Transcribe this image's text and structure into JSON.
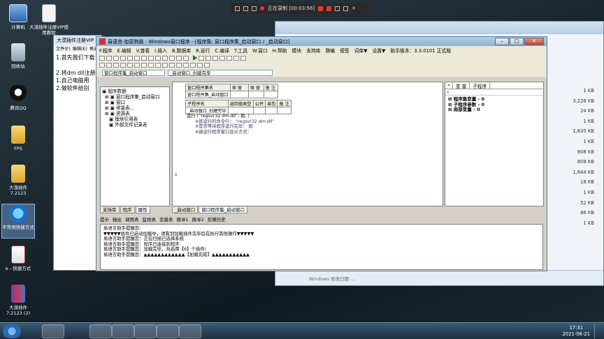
{
  "desktop": {
    "icons": [
      {
        "label": "计算机"
      },
      {
        "label": "大漠插件注册VIP使用教程"
      },
      {
        "label": "回收站"
      },
      {
        "label": "腾讯QQ"
      },
      {
        "label": "FPS"
      },
      {
        "label": "大漠插件 7.2123"
      },
      {
        "label": "不常用快捷方式"
      },
      {
        "label": "e - 快捷方式"
      },
      {
        "label": "大漠插件 7.2123 (2)"
      }
    ]
  },
  "recorder": {
    "status": "正在录制 [00:03:56]"
  },
  "notepad": {
    "title": "大漠插件注册VIP",
    "menu": [
      "文件(F)",
      "编辑(E)",
      "格式(O)"
    ],
    "lines": [
      "1.首先我们下载",
      "",
      "2.将dm.dll注册",
      "1.自己电脑用",
      "2.做软件给别"
    ]
  },
  "explorer": {
    "sizes": [
      "1 KB",
      "3,226 KB",
      "24 KB",
      "1 KB",
      "1,835 KB",
      "1 KB",
      "808 KB",
      "808 KB",
      "1,844 KB",
      "18 KB",
      "1 KB",
      "52 KB",
      "86 KB",
      "1 KB"
    ],
    "status": "Windows 修改日期 ..."
  },
  "app": {
    "title": "易语言-加密狗版 - Windows窗口程序 - [程序集: 窗口程序集_启动窗口 / _启动窗口]",
    "menu": [
      "F.程序",
      "E.编辑",
      "V.查看",
      "I.插入",
      "B.数据库",
      "R.运行",
      "C.编译",
      "T.工具",
      "W.窗口",
      "H.帮助",
      "模块",
      "支持库",
      "静编",
      "便签",
      "词库▼",
      "设置▼",
      "助手版本：3.3.0101 正式版"
    ],
    "combo_left": "窗口程序集_启动窗口",
    "combo_right": "_启动窗口_创建完毕",
    "tree": {
      "root": "程序数据",
      "items": [
        "窗口程序集_启动窗口",
        "窗口",
        "常量表...",
        "资源表",
        "模块引用表",
        "外部文件记录表"
      ]
    },
    "assembly_table": {
      "headers": [
        "窗口程序集名",
        "保 留",
        "保 留",
        "备 注"
      ],
      "row": [
        "窗口程序集_启动窗口",
        "",
        "",
        ""
      ]
    },
    "sub_table": {
      "headers": [
        "子程序名",
        "返回值类型",
        "公开",
        "易包",
        "备 注"
      ],
      "row": [
        "_启动窗口_创建完毕",
        "",
        "",
        "",
        ""
      ]
    },
    "code": {
      "line1": "运行 (“regsvr32 dm.dll”, 假, )",
      "line2": "※欲运行的命令行：  “regsvr32 dm.dll”",
      "line3": "※是否等待程序运行完毕：  假",
      "line4": "※被运行程序窗口显示方式："
    },
    "right_tabs": [
      "变 量",
      "子程序"
    ],
    "right_items": [
      "程序集变量 - 0",
      "子程序参数 - 0",
      "局部变量 - 0"
    ],
    "left_tabs": [
      "支持库",
      "程序",
      "属性"
    ],
    "editor_tabs": [
      "_启动窗口",
      "窗口程序集_启动窗口"
    ],
    "bottom_tabs": [
      "提示",
      "输出",
      "调用表",
      "监视表",
      "变量表",
      "搜寻1",
      "搜寻2",
      "剪辑历史"
    ],
    "output_lines": [
      "易语言助手提醒您:",
      "▼▼▼▼▼插件已启动加载中，请看到加载插件完毕后在执行其他操作▼▼▼▼▼",
      "易语言助手提醒您：正在扫描已选择系统",
      "易语言助手提醒您：程序已连接到程序",
      "易语言助手提醒您：加载完毕，共启用【6】个插件!",
      "易语言助手提醒您：▲▲▲▲▲▲▲▲▲▲▲▲【加载完成】▲▲▲▲▲▲▲▲▲▲▲"
    ]
  },
  "taskbar": {
    "clock_time": "17:31",
    "clock_date": "2021-06-21"
  }
}
